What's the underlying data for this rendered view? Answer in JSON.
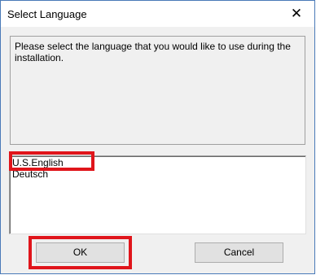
{
  "window": {
    "title": "Select Language",
    "close_glyph": "✕"
  },
  "message": "Please select the language that you would like to use during the installation.",
  "languages": [
    "U.S.English",
    "Deutsch"
  ],
  "buttons": {
    "ok": "OK",
    "cancel": "Cancel"
  },
  "colors": {
    "highlight": "#e0151b",
    "window_border": "#4a7ab8",
    "dialog_bg": "#f0f0f0"
  }
}
